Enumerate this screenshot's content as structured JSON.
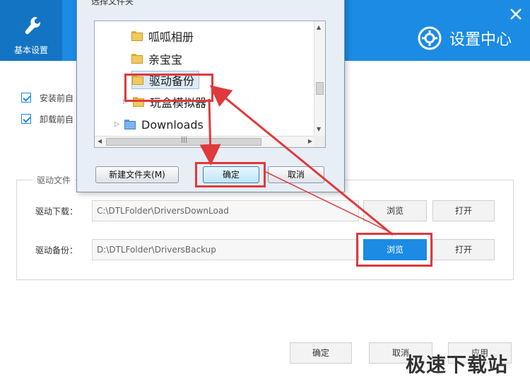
{
  "header": {
    "nav_item_label": "基本设置",
    "title": "设置中心",
    "color": "#1b8be3"
  },
  "options": [
    {
      "label": "安装前自",
      "checked": true
    },
    {
      "label": "卸载前自",
      "checked": true
    }
  ],
  "driver_group": {
    "title": "驱动文件",
    "download": {
      "label": "驱动下载：",
      "path": "C:\\DTLFolder\\DriversDownLoad",
      "browse": "浏览",
      "open": "打开"
    },
    "backup": {
      "label": "驱动备份：",
      "path": "D:\\DTLFolder\\DriversBackup",
      "browse": "浏览",
      "open": "打开"
    }
  },
  "footer": {
    "ok": "确定",
    "cancel": "取消",
    "apply": "应用"
  },
  "dialog": {
    "title": "选择文件夹",
    "tree": [
      {
        "label": "呱呱相册",
        "selected": false,
        "expandable": false
      },
      {
        "label": "亲宝宝",
        "selected": false,
        "expandable": false
      },
      {
        "label": "驱动备份",
        "selected": true,
        "expandable": false
      },
      {
        "label": "玩盒模拟器",
        "selected": false,
        "expandable": true
      },
      {
        "label": "Downloads",
        "selected": false,
        "expandable": true
      }
    ],
    "new_folder": "新建文件夹(M)",
    "ok": "确定",
    "cancel": "取消"
  },
  "watermark": "极速下载站",
  "highlight_color": "#e0393b"
}
